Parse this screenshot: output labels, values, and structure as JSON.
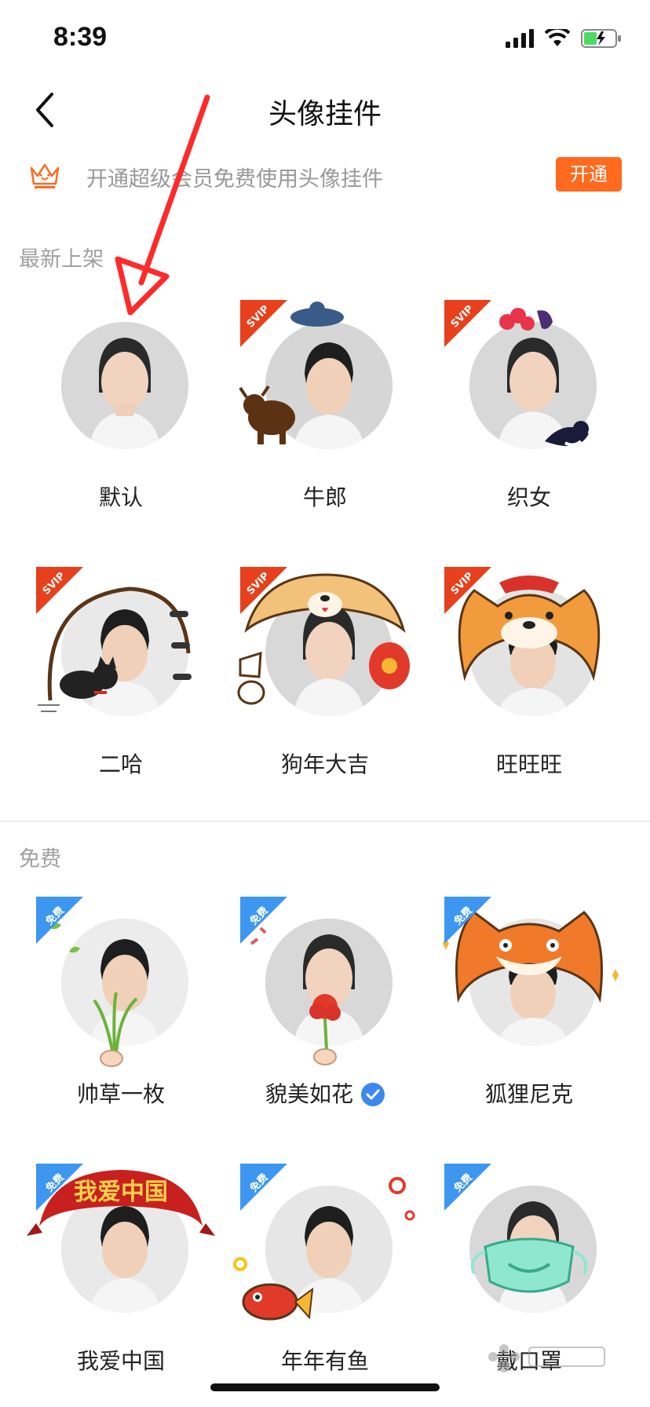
{
  "status_bar": {
    "time": "8:39"
  },
  "nav": {
    "title": "头像挂件"
  },
  "promo": {
    "text": "开通超级会员免费使用头像挂件",
    "button": "开通"
  },
  "sections": [
    {
      "title": "最新上架",
      "items": [
        {
          "label": "默认",
          "tag": ""
        },
        {
          "label": "牛郎",
          "tag": "SVIP"
        },
        {
          "label": "织女",
          "tag": "SVIP"
        },
        {
          "label": "二哈",
          "tag": "SVIP"
        },
        {
          "label": "狗年大吉",
          "tag": "SVIP"
        },
        {
          "label": "旺旺旺",
          "tag": "SVIP"
        }
      ]
    },
    {
      "title": "免费",
      "items": [
        {
          "label": "帅草一枚",
          "tag": "免费"
        },
        {
          "label": "貌美如花",
          "tag": "免费",
          "selected": true
        },
        {
          "label": "狐狸尼克",
          "tag": "免费"
        },
        {
          "label": "我爱中国",
          "tag": "免费",
          "banner_text": "我爱中国"
        },
        {
          "label": "年年有鱼",
          "tag": "免费"
        },
        {
          "label": "戴口罩",
          "tag": "免费"
        }
      ]
    }
  ],
  "colors": {
    "accent_orange": "#ff6a1e",
    "svip_red": "#e8401c",
    "free_blue": "#3d97f1",
    "annotation_red": "#ff2a2a"
  },
  "icons": [
    "back-chevron-icon",
    "crown-icon",
    "signal-icon",
    "wifi-icon",
    "battery-icon",
    "check-icon"
  ]
}
